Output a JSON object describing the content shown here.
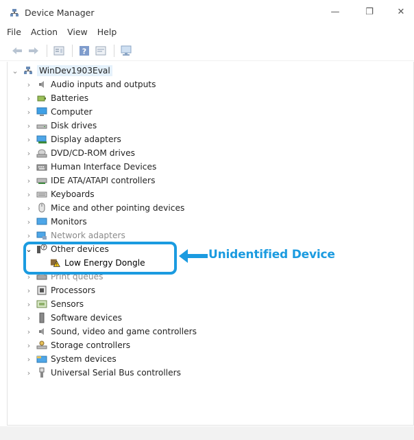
{
  "window": {
    "title": "Device Manager",
    "controls": {
      "minimize": "—",
      "maximize": "❐",
      "close": "✕"
    }
  },
  "menu": [
    "File",
    "Action",
    "View",
    "Help"
  ],
  "toolbar": [
    "back-icon",
    "forward-icon",
    "properties-icon",
    "help-icon",
    "show-hidden-icon",
    "scan-hardware-icon"
  ],
  "tree": {
    "root": "WinDev1903Eval",
    "categories": [
      {
        "label": "Audio inputs and outputs",
        "icon": "speaker-icon"
      },
      {
        "label": "Batteries",
        "icon": "battery-icon"
      },
      {
        "label": "Computer",
        "icon": "computer-icon"
      },
      {
        "label": "Disk drives",
        "icon": "disk-drive-icon"
      },
      {
        "label": "Display adapters",
        "icon": "display-adapter-icon"
      },
      {
        "label": "DVD/CD-ROM drives",
        "icon": "dvd-drive-icon"
      },
      {
        "label": "Human Interface Devices",
        "icon": "hid-icon"
      },
      {
        "label": "IDE ATA/ATAPI controllers",
        "icon": "ide-controller-icon"
      },
      {
        "label": "Keyboards",
        "icon": "keyboard-icon"
      },
      {
        "label": "Mice and other pointing devices",
        "icon": "mouse-icon"
      },
      {
        "label": "Monitors",
        "icon": "monitor-icon"
      },
      {
        "label": "Network adapters",
        "icon": "network-adapter-icon"
      },
      {
        "label": "Other devices",
        "icon": "unknown-device-icon",
        "expanded": true,
        "children": [
          {
            "label": "Low Energy Dongle",
            "icon": "warning-device-icon"
          }
        ]
      },
      {
        "label": "Print queues",
        "icon": "printer-icon"
      },
      {
        "label": "Processors",
        "icon": "processor-icon"
      },
      {
        "label": "Sensors",
        "icon": "sensor-icon"
      },
      {
        "label": "Software devices",
        "icon": "software-device-icon"
      },
      {
        "label": "Sound, video and game controllers",
        "icon": "sound-icon"
      },
      {
        "label": "Storage controllers",
        "icon": "storage-controller-icon"
      },
      {
        "label": "System devices",
        "icon": "system-devices-icon"
      },
      {
        "label": "Universal Serial Bus controllers",
        "icon": "usb-icon"
      }
    ]
  },
  "annotation": {
    "text": "Unidentified Device",
    "color": "#1b9be0"
  },
  "colors": {
    "accent": "#1b9be0",
    "selection": "#e5f1fb"
  }
}
